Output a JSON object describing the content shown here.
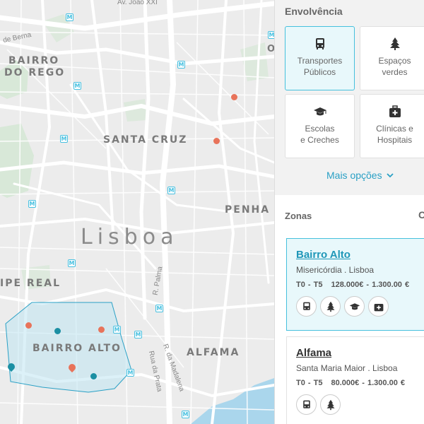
{
  "map": {
    "city_label": "Lisboa",
    "neighborhoods": {
      "bairro_do_rego_1": "BAIRRO",
      "bairro_do_rego_2": "DO REGO",
      "santa_cruz": "SANTA CRUZ",
      "penha": "PENHA",
      "principe_real": "IPE REAL",
      "bairro_alto": "BAIRRO ALTO",
      "alfama": "ALFAMA"
    },
    "streets": {
      "av_joao_xxi": "Av. João XXI",
      "de_berna": "de Berna",
      "r_palma": "R. Palma",
      "r_madalena": "R. da Madalena",
      "rua_prata": "Rua da Prata"
    },
    "metro_symbol": "M",
    "cut_letter": "O",
    "colors": {
      "water": "#aad6ec",
      "park": "#d8e8d8",
      "zone_fill": "#bfe6f3",
      "zone_stroke": "#2aa0c5"
    }
  },
  "sidebar": {
    "envolvencia_title": "Envolvência",
    "categories": [
      {
        "icon": "bus-icon",
        "label1": "Transportes",
        "label2": "Públicos",
        "active": true
      },
      {
        "icon": "tree-icon",
        "label1": "Espaços",
        "label2": "verdes",
        "active": false
      },
      {
        "icon": "graduation-cap-icon",
        "label1": "Escolas",
        "label2": "e Creches",
        "active": false
      },
      {
        "icon": "medical-kit-icon",
        "label1": "Clínicas e",
        "label2": "Hospitais",
        "active": false
      }
    ],
    "more_options": "Mais opções",
    "zones_title": "Zonas",
    "zones_cut": "C",
    "zones": [
      {
        "name": "Bairro Alto",
        "subtitle": "Misericórdia . Lisboa",
        "typology": "T0 - T5",
        "price": "128.000€ - 1.300.00 €"
      },
      {
        "name": "Alfama",
        "subtitle": "Santa Maria Maior . Lisboa",
        "typology": "T0 - T5",
        "price": "80.000€ - 1.300.00 €"
      }
    ]
  }
}
